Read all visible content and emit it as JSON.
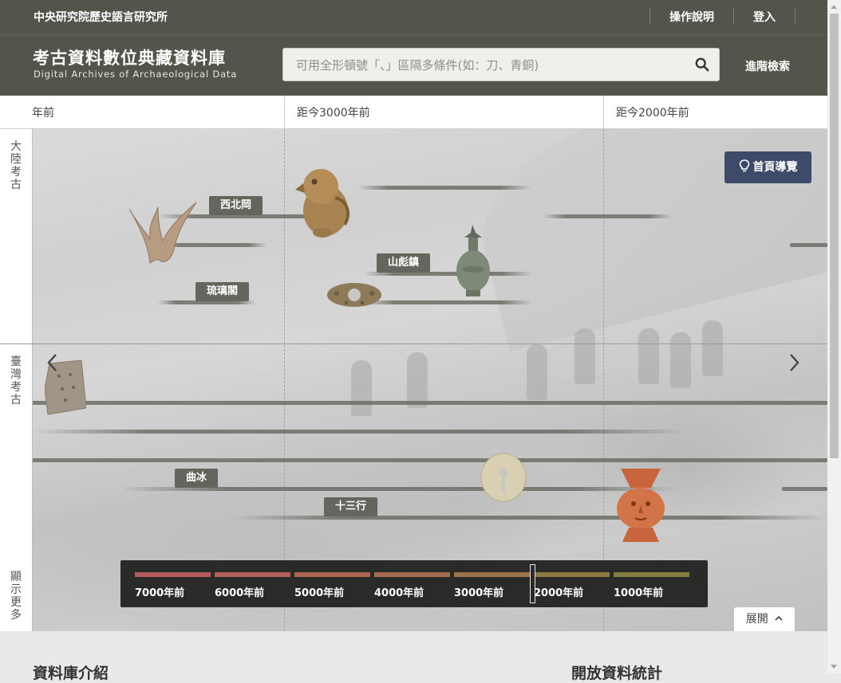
{
  "header": {
    "institute": "中央研究院歷史語言研究所",
    "nav": [
      {
        "label": "操作說明"
      },
      {
        "label": "登入"
      }
    ]
  },
  "brand": {
    "title_zh": "考古資料數位典藏資料庫",
    "title_en": "Digital Archives of Archaeological Data"
  },
  "search": {
    "placeholder": "可用全形頓號「、」區隔多條件(如：刀、青銅)",
    "value": "",
    "icon": "search-icon",
    "advanced_label": "進階檢索"
  },
  "timeline": {
    "ruler_labels": [
      "年前",
      "距今3000年前",
      "距今2000年前"
    ],
    "rows": [
      {
        "label": "大陸考古"
      },
      {
        "label": "臺灣考古"
      }
    ],
    "more_label": "顯示更多",
    "guide_button": "首頁導覽",
    "guide_icon": "lightbulb-icon",
    "prev_icon": "chevron-left-icon",
    "next_icon": "chevron-right-icon",
    "sites": [
      {
        "name": "西北岡"
      },
      {
        "name": "山彪鎮"
      },
      {
        "name": "琉璃閣"
      },
      {
        "name": "曲冰"
      },
      {
        "name": "十三行"
      }
    ],
    "scrubber": {
      "labels": [
        "7000年前",
        "6000年前",
        "5000年前",
        "4000年前",
        "3000年前",
        "2000年前",
        "1000年前"
      ],
      "colors": [
        "#b5595a",
        "#b35e57",
        "#ae6453",
        "#a56c4f",
        "#9b7449",
        "#8d7a43",
        "#857e3f"
      ]
    },
    "expand_label": "展開",
    "expand_icon": "chevron-up-icon"
  },
  "footer_preview": {
    "left_heading": "資料庫介紹",
    "right_heading": "開放資料統計"
  },
  "colors": {
    "header_bg": "#52554a",
    "guide_bg": "#3e4a6a",
    "site_tag_bg": "#63665d",
    "scrubber_bg": "#2a2a28"
  }
}
